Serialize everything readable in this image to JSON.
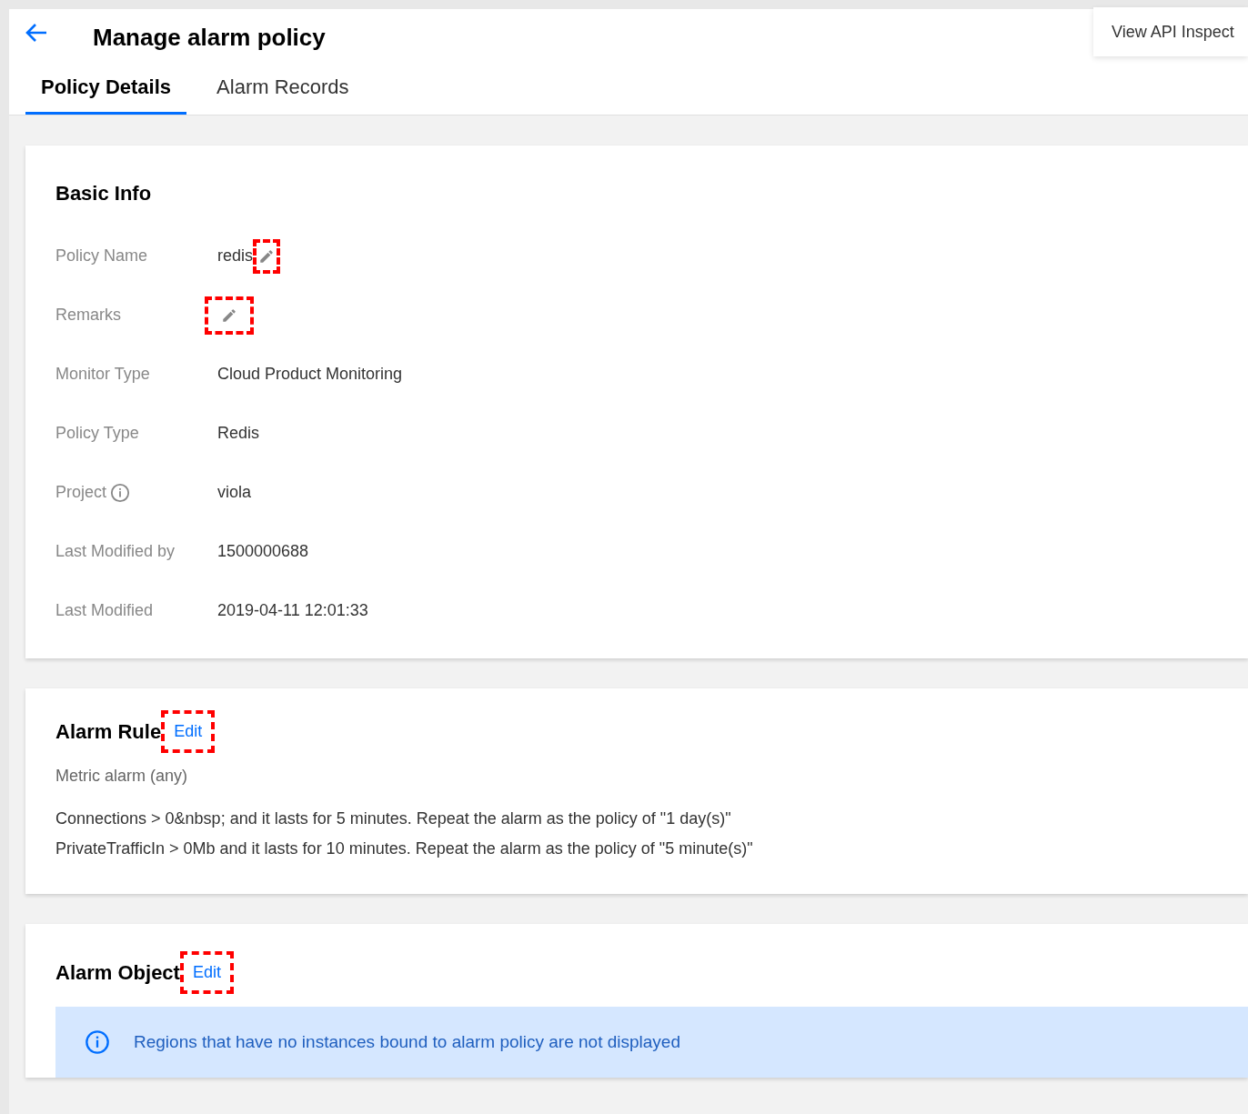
{
  "header": {
    "title": "Manage alarm policy",
    "api_button": "View API Inspect"
  },
  "tabs": [
    {
      "label": "Policy Details",
      "selected": true
    },
    {
      "label": "Alarm Records",
      "selected": false
    }
  ],
  "basic_info": {
    "title": "Basic Info",
    "fields": [
      {
        "label": "Policy Name",
        "value": "redis",
        "info": false,
        "edit_icon": {
          "highlighted": true
        }
      },
      {
        "label": "Remarks",
        "info": false,
        "edit_icon": {
          "highlighted": true
        }
      },
      {
        "label": "Monitor Type",
        "value": "Cloud Product Monitoring",
        "info": false
      },
      {
        "label": "Policy Type",
        "value": "Redis",
        "info": false
      },
      {
        "label": "Project",
        "value": "viola",
        "info": true
      },
      {
        "label": "Last Modified by",
        "value": "1500000688",
        "info": false
      },
      {
        "label": "Last Modified",
        "value": "2019-04-11 12:01:33",
        "info": false
      }
    ]
  },
  "alarm_rule": {
    "title": "Alarm Rule",
    "edit_link": {
      "label": "Edit",
      "highlighted": true
    },
    "type": "Metric alarm (any)",
    "rules": [
      "Connections > 0&nbsp; and it lasts for 5 minutes. Repeat the alarm as the policy of \"1 day(s)\"",
      "PrivateTrafficIn > 0Mb and it lasts for 10 minutes. Repeat the alarm as the policy of \"5 minute(s)\""
    ]
  },
  "alarm_object": {
    "title": "Alarm Object",
    "edit_link": {
      "label": "Edit",
      "highlighted": true
    },
    "notice": "Regions that have no instances bound to alarm policy are not displayed"
  }
}
